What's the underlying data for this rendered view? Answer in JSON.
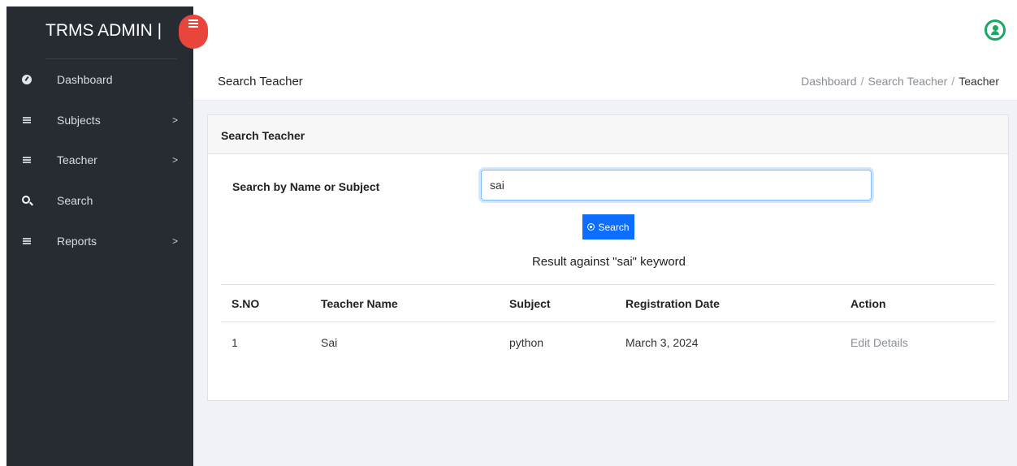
{
  "sidebar": {
    "brand": "TRMS ADMIN |",
    "items": [
      {
        "label": "Dashboard",
        "icon": "dashboard-icon",
        "chevron": false
      },
      {
        "label": "Subjects",
        "icon": "list-icon",
        "chevron": true
      },
      {
        "label": "Teacher",
        "icon": "list-icon",
        "chevron": true
      },
      {
        "label": "Search",
        "icon": "search-icon",
        "chevron": false
      },
      {
        "label": "Reports",
        "icon": "list-icon",
        "chevron": true
      }
    ],
    "chevron_glyph": ">"
  },
  "header": {
    "page_title": "Search Teacher",
    "breadcrumb": [
      "Dashboard",
      "Search Teacher",
      "Teacher"
    ],
    "breadcrumb_sep": "/"
  },
  "card": {
    "title": "Search Teacher",
    "search_label": "Search by Name or Subject",
    "search_value": "sai",
    "search_button": "Search",
    "result_text": "Result against \"sai\" keyword",
    "table": {
      "columns": [
        "S.NO",
        "Teacher Name",
        "Subject",
        "Registration Date",
        "Action"
      ],
      "rows": [
        [
          "1",
          "Sai",
          "python",
          "March 3, 2024",
          "Edit Details"
        ]
      ]
    }
  },
  "colors": {
    "sidebar_bg": "#272c33",
    "toggle_red": "#e8453c",
    "user_green": "#1aa862",
    "primary_blue": "#0d6efd"
  }
}
